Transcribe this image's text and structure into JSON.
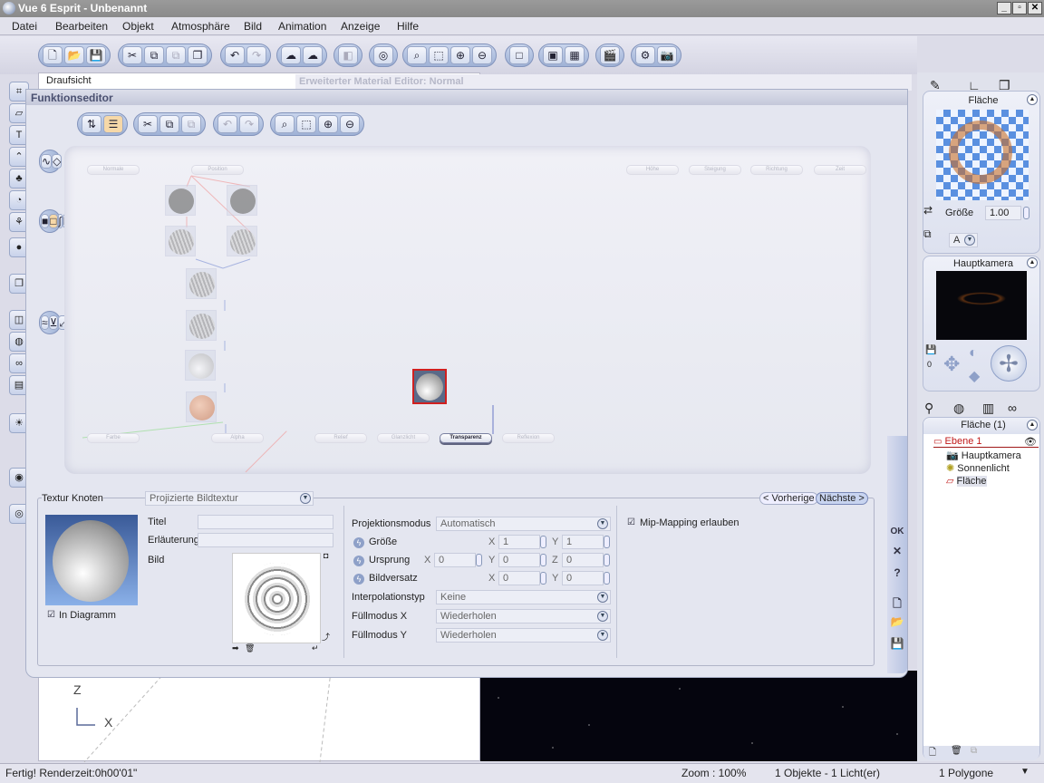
{
  "window": {
    "title": "Vue 6 Esprit - Unbenannt",
    "controls": [
      "_",
      "▫",
      "✕"
    ]
  },
  "menu": [
    "Datei",
    "Bearbeiten",
    "Objekt",
    "Atmosphäre",
    "Bild",
    "Animation",
    "Anzeige",
    "Hilfe"
  ],
  "toolbar_groups": [
    [
      "new-icon",
      "open-icon",
      "save-icon"
    ],
    [
      "cut-icon",
      "copy-icon",
      "paste-icon",
      "duplicate-icon"
    ],
    [
      "undo-icon",
      "redo-icon"
    ],
    [
      "load-atmosphere-icon",
      "atmosphere-editor-icon"
    ],
    [
      "material-icon"
    ],
    [
      "render-options-icon"
    ],
    [
      "zoom-fit-icon",
      "zoom-region-icon",
      "zoom-in-icon",
      "zoom-out-icon"
    ],
    [
      "view-icon"
    ],
    [
      "render-area-icon",
      "render-icon"
    ],
    [
      "animation-icon"
    ],
    [
      "camera-options-icon",
      "snapshot-icon"
    ]
  ],
  "viewports": {
    "top_label": "Draufsicht",
    "axis_z": "Z",
    "axis_x": "X"
  },
  "material_editor_title": "Erweiterter Material Editor: Normal",
  "function_editor": {
    "title": "Funktionseditor",
    "inputs_top": [
      "Normale",
      "Position",
      "Höhe",
      "Steigung",
      "Richtung",
      "Zeit"
    ],
    "outputs_bottom": [
      "Farbe",
      "Alpha",
      "Relief",
      "Glanzlicht",
      "Transparenz",
      "Reflexion"
    ],
    "active_output": "Transparenz",
    "node_panel": {
      "section": "Textur Knoten",
      "node_type": "Projizierte Bildtextur",
      "prev": "< Vorherige",
      "next": "Nächste >",
      "title_label": "Titel",
      "title_value": "",
      "desc_label": "Erläuterung",
      "desc_value": "",
      "image_label": "Bild",
      "in_diagram": "In Diagramm",
      "projection_label": "Projektionsmodus",
      "projection_value": "Automatisch",
      "size_label": "Größe",
      "size_x": "1",
      "size_y": "1",
      "origin_label": "Ursprung",
      "origin_x": "0",
      "origin_y": "0",
      "origin_z": "0",
      "offset_label": "Bildversatz",
      "offset_x": "0",
      "offset_y": "0",
      "interp_label": "Interpolationstyp",
      "interp_value": "Keine",
      "fillx_label": "Füllmodus X",
      "fillx_value": "Wiederholen",
      "filly_label": "Füllmodus Y",
      "filly_value": "Wiederholen",
      "mip_label": "Mip-Mapping erlauben",
      "ax": "X",
      "ay": "Y",
      "az": "Z"
    },
    "side_buttons": {
      "ok": "OK",
      "cancel": "✕",
      "help": "?"
    }
  },
  "right_panel": {
    "material_title": "Fläche",
    "size_label": "Größe",
    "size_value": "1.00",
    "layer_value": "A",
    "camera_title": "Hauptkamera",
    "frame": "0",
    "world_title": "Fläche (1)",
    "tree": [
      "Ebene 1",
      "Hauptkamera",
      "Sonnenlicht",
      "Fläche"
    ]
  },
  "status": {
    "message": "Fertig! Renderzeit:0h00'01\"",
    "zoom": "Zoom : 100%",
    "objects": "1 Objekte - 1 Licht(er)",
    "polygons": "1 Polygone"
  }
}
